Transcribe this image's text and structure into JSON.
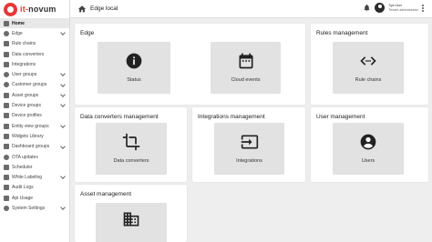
{
  "app": {
    "logo_text": "it-novum",
    "logo_brand": "it-",
    "logo_rest": "novum"
  },
  "header": {
    "title": "Edge local",
    "user_name": "Sys User",
    "user_role": "Tenant administrator"
  },
  "sidebar": {
    "items": [
      {
        "label": "Home"
      },
      {
        "label": "Edge"
      },
      {
        "label": "Rule chains"
      },
      {
        "label": "Data converters"
      },
      {
        "label": "Integrations"
      },
      {
        "label": "User groups"
      },
      {
        "label": "Customer groups"
      },
      {
        "label": "Asset groups"
      },
      {
        "label": "Device groups"
      },
      {
        "label": "Device profiles"
      },
      {
        "label": "Entity view groups"
      },
      {
        "label": "Widgets Library"
      },
      {
        "label": "Dashboard groups"
      },
      {
        "label": "OTA updates"
      },
      {
        "label": "Scheduler"
      },
      {
        "label": "White Labeling"
      },
      {
        "label": "Audit Logs"
      },
      {
        "label": "Api Usage"
      },
      {
        "label": "System Settings"
      }
    ]
  },
  "cards": [
    {
      "title": "Edge",
      "tiles": [
        {
          "label": "Status",
          "icon": "info-icon"
        },
        {
          "label": "Cloud events",
          "icon": "calendar-icon"
        }
      ]
    },
    {
      "title": "Rules management",
      "tiles": [
        {
          "label": "Rule chains",
          "icon": "code-arrows-icon"
        }
      ]
    },
    {
      "title": "Data converters management",
      "tiles": [
        {
          "label": "Data converters",
          "icon": "crop-icon"
        }
      ]
    },
    {
      "title": "Integrations management",
      "tiles": [
        {
          "label": "Integrations",
          "icon": "input-icon"
        }
      ]
    },
    {
      "title": "User management",
      "tiles": [
        {
          "label": "Users",
          "icon": "account-icon"
        }
      ]
    },
    {
      "title": "Asset management",
      "tiles": [
        {
          "label": "",
          "icon": "building-icon"
        }
      ]
    }
  ],
  "colors": {
    "brand": "#e53935",
    "tile": "#e2e2e2",
    "background": "#eeeeee",
    "icon": "#222222"
  }
}
